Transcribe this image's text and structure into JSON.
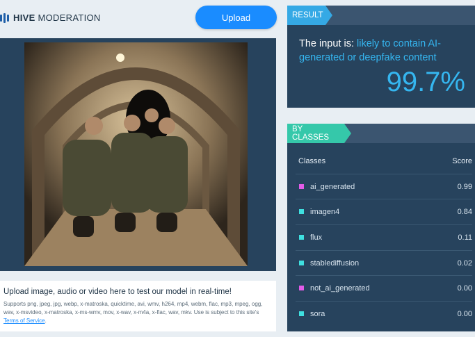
{
  "brand": {
    "bold": "HIVE",
    "rest": " MODERATION"
  },
  "upload_button": "Upload",
  "info": {
    "title": "Upload image, audio or video here to test our model in real-time!",
    "supports": "Supports png, jpeg, jpg, webp, x-matroska, quicktime, avi, wmv, h264, mp4, webm, flac, mp3, mpeg, ogg, wav, x-msvideo, x-matroska, x-ms-wmv, mov, x-wav, x-m4a, x-flac, wav, mkv. Use is subject to this site's ",
    "terms_link": "Terms of Service",
    "period": "."
  },
  "result": {
    "tag": "RESULT",
    "prefix": "The input is: ",
    "verdict": "likely to contain AI-generated or deepfake content",
    "score": "99.7%"
  },
  "classes": {
    "tag": "BY CLASSES",
    "header": {
      "name": "Classes",
      "score": "Score"
    },
    "rows": [
      {
        "name": "ai_generated",
        "score": "0.99",
        "color": "#e25ce8"
      },
      {
        "name": "imagen4",
        "score": "0.84",
        "color": "#3fe0e0"
      },
      {
        "name": "flux",
        "score": "0.11",
        "color": "#3fe0e0"
      },
      {
        "name": "stablediffusion",
        "score": "0.02",
        "color": "#3fe0e0"
      },
      {
        "name": "not_ai_generated",
        "score": "0.00",
        "color": "#e25ce8"
      },
      {
        "name": "sora",
        "score": "0.00",
        "color": "#3fe0e0"
      }
    ]
  },
  "colors": {
    "accent": "#1a8cff",
    "panel": "#27435d",
    "score": "#35b6f0"
  }
}
